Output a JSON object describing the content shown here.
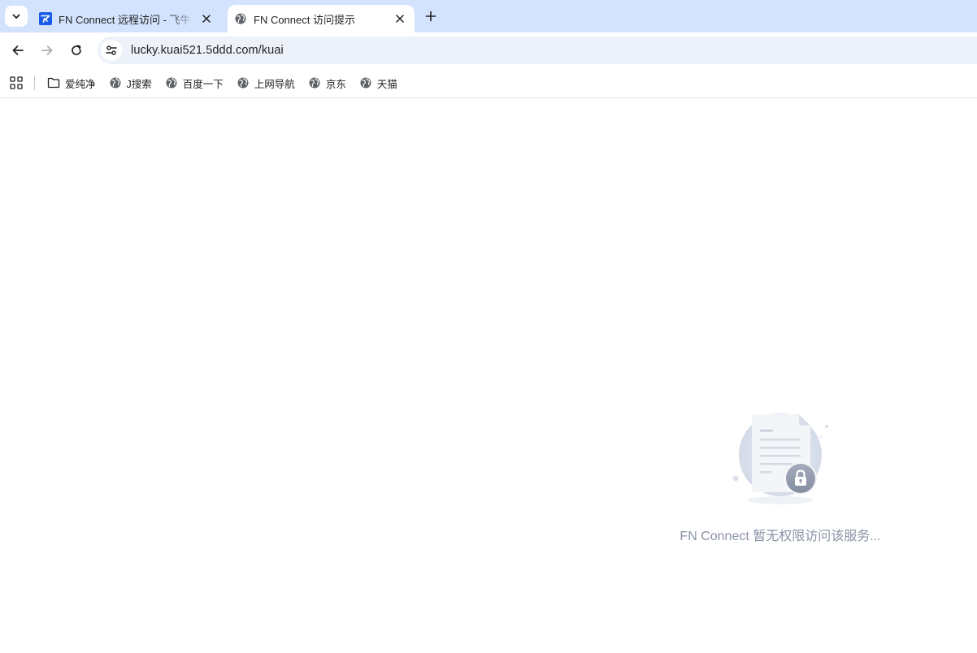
{
  "browser": {
    "tabs": [
      {
        "title": "FN Connect 远程访问 - 飞牛 fnOS",
        "active": false,
        "icon": "fn-connect-icon"
      },
      {
        "title": "FN Connect 访问提示",
        "active": true,
        "icon": "globe-icon"
      }
    ],
    "address_bar": {
      "url": "lucky.kuai521.5ddd.com/kuai"
    },
    "bookmarks": [
      {
        "label": "爱纯净",
        "icon": "folder-icon"
      },
      {
        "label": "J搜索",
        "icon": "globe-icon"
      },
      {
        "label": "百度一下",
        "icon": "globe-icon"
      },
      {
        "label": "上网导航",
        "icon": "globe-icon"
      },
      {
        "label": "京东",
        "icon": "globe-icon"
      },
      {
        "label": "天猫",
        "icon": "globe-icon"
      }
    ]
  },
  "page": {
    "message": "FN Connect 暂无权限访问该服务...",
    "illustration": "locked-document-icon"
  },
  "colors": {
    "tabstrip_bg": "#d3e3fd",
    "omnibox_bg": "#edf2fa",
    "message_text": "#8a93a6",
    "tab_favicon_blue": "#1a5ce5"
  }
}
